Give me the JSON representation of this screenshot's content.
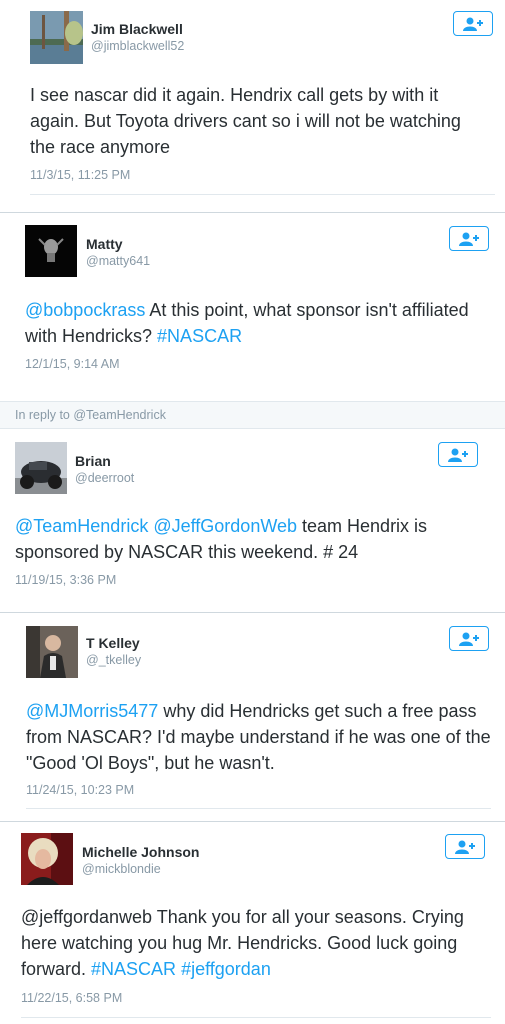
{
  "colors": {
    "link": "#1da1f2",
    "text": "#292f33",
    "meta": "#8899a6"
  },
  "follow_icon": "add-user-icon",
  "tweets": [
    {
      "name": "Jim Blackwell",
      "handle": "@jimblackwell52",
      "text_parts": [
        "I see nascar did it again. Hendrix call gets by with it again. But Toyota drivers cant so i will not be watching the race anymore"
      ],
      "time": "11/3/15, 11:25 PM"
    },
    {
      "name": "Matty",
      "handle": "@matty641",
      "text_parts": [
        "@bobpockrass",
        " At this point, what sponsor isn't affiliated with Hendricks? ",
        "#NASCAR"
      ],
      "time": "12/1/15, 9:14 AM"
    },
    {
      "reply_to": "In reply to @TeamHendrick",
      "name": "Brian",
      "handle": "@deerroot",
      "text_parts": [
        "@TeamHendrick",
        " ",
        "@JeffGordonWeb",
        " team Hendrix  is sponsored  by NASCAR  this weekend. # 24"
      ],
      "time": "11/19/15, 3:36 PM"
    },
    {
      "name": "T Kelley",
      "handle": "@_tkelley",
      "text_parts": [
        "@MJMorris5477",
        " why did Hendricks get such a free pass from NASCAR? I'd maybe understand if he was one of the \"Good 'Ol Boys\", but he wasn't."
      ],
      "time": "11/24/15, 10:23 PM"
    },
    {
      "name": "Michelle Johnson",
      "handle": "@mickblondie",
      "text_parts": [
        "@jeffgordanweb Thank you for all your seasons.  Crying here watching you hug Mr. Hendricks.  Good luck going forward. ",
        "#NASCAR",
        " ",
        "#jeffgordan"
      ],
      "time": "11/22/15, 6:58 PM"
    }
  ]
}
